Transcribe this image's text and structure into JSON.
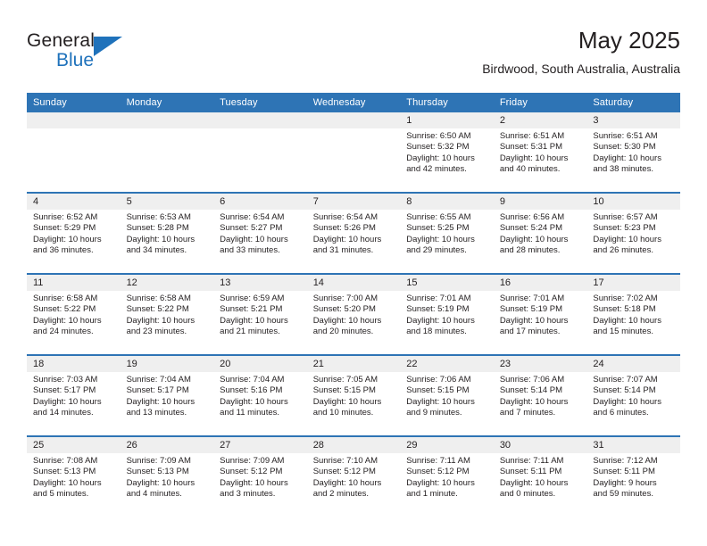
{
  "logo": {
    "word1": "General",
    "word2": "Blue",
    "triangle_icon": "triangle-icon",
    "brand_color": "#1f72bb"
  },
  "header": {
    "title": "May 2025",
    "subtitle": "Birdwood, South Australia, Australia"
  },
  "theme": {
    "header_blue": "#2e74b5",
    "daynum_band": "#efefef",
    "text": "#231f20"
  },
  "weekday_headers": [
    "Sunday",
    "Monday",
    "Tuesday",
    "Wednesday",
    "Thursday",
    "Friday",
    "Saturday"
  ],
  "weeks": [
    [
      {
        "day": "",
        "empty": true
      },
      {
        "day": "",
        "empty": true
      },
      {
        "day": "",
        "empty": true
      },
      {
        "day": "",
        "empty": true
      },
      {
        "day": "1",
        "sunrise": "Sunrise: 6:50 AM",
        "sunset": "Sunset: 5:32 PM",
        "daylight1": "Daylight: 10 hours",
        "daylight2": "and 42 minutes."
      },
      {
        "day": "2",
        "sunrise": "Sunrise: 6:51 AM",
        "sunset": "Sunset: 5:31 PM",
        "daylight1": "Daylight: 10 hours",
        "daylight2": "and 40 minutes."
      },
      {
        "day": "3",
        "sunrise": "Sunrise: 6:51 AM",
        "sunset": "Sunset: 5:30 PM",
        "daylight1": "Daylight: 10 hours",
        "daylight2": "and 38 minutes."
      }
    ],
    [
      {
        "day": "4",
        "sunrise": "Sunrise: 6:52 AM",
        "sunset": "Sunset: 5:29 PM",
        "daylight1": "Daylight: 10 hours",
        "daylight2": "and 36 minutes."
      },
      {
        "day": "5",
        "sunrise": "Sunrise: 6:53 AM",
        "sunset": "Sunset: 5:28 PM",
        "daylight1": "Daylight: 10 hours",
        "daylight2": "and 34 minutes."
      },
      {
        "day": "6",
        "sunrise": "Sunrise: 6:54 AM",
        "sunset": "Sunset: 5:27 PM",
        "daylight1": "Daylight: 10 hours",
        "daylight2": "and 33 minutes."
      },
      {
        "day": "7",
        "sunrise": "Sunrise: 6:54 AM",
        "sunset": "Sunset: 5:26 PM",
        "daylight1": "Daylight: 10 hours",
        "daylight2": "and 31 minutes."
      },
      {
        "day": "8",
        "sunrise": "Sunrise: 6:55 AM",
        "sunset": "Sunset: 5:25 PM",
        "daylight1": "Daylight: 10 hours",
        "daylight2": "and 29 minutes."
      },
      {
        "day": "9",
        "sunrise": "Sunrise: 6:56 AM",
        "sunset": "Sunset: 5:24 PM",
        "daylight1": "Daylight: 10 hours",
        "daylight2": "and 28 minutes."
      },
      {
        "day": "10",
        "sunrise": "Sunrise: 6:57 AM",
        "sunset": "Sunset: 5:23 PM",
        "daylight1": "Daylight: 10 hours",
        "daylight2": "and 26 minutes."
      }
    ],
    [
      {
        "day": "11",
        "sunrise": "Sunrise: 6:58 AM",
        "sunset": "Sunset: 5:22 PM",
        "daylight1": "Daylight: 10 hours",
        "daylight2": "and 24 minutes."
      },
      {
        "day": "12",
        "sunrise": "Sunrise: 6:58 AM",
        "sunset": "Sunset: 5:22 PM",
        "daylight1": "Daylight: 10 hours",
        "daylight2": "and 23 minutes."
      },
      {
        "day": "13",
        "sunrise": "Sunrise: 6:59 AM",
        "sunset": "Sunset: 5:21 PM",
        "daylight1": "Daylight: 10 hours",
        "daylight2": "and 21 minutes."
      },
      {
        "day": "14",
        "sunrise": "Sunrise: 7:00 AM",
        "sunset": "Sunset: 5:20 PM",
        "daylight1": "Daylight: 10 hours",
        "daylight2": "and 20 minutes."
      },
      {
        "day": "15",
        "sunrise": "Sunrise: 7:01 AM",
        "sunset": "Sunset: 5:19 PM",
        "daylight1": "Daylight: 10 hours",
        "daylight2": "and 18 minutes."
      },
      {
        "day": "16",
        "sunrise": "Sunrise: 7:01 AM",
        "sunset": "Sunset: 5:19 PM",
        "daylight1": "Daylight: 10 hours",
        "daylight2": "and 17 minutes."
      },
      {
        "day": "17",
        "sunrise": "Sunrise: 7:02 AM",
        "sunset": "Sunset: 5:18 PM",
        "daylight1": "Daylight: 10 hours",
        "daylight2": "and 15 minutes."
      }
    ],
    [
      {
        "day": "18",
        "sunrise": "Sunrise: 7:03 AM",
        "sunset": "Sunset: 5:17 PM",
        "daylight1": "Daylight: 10 hours",
        "daylight2": "and 14 minutes."
      },
      {
        "day": "19",
        "sunrise": "Sunrise: 7:04 AM",
        "sunset": "Sunset: 5:17 PM",
        "daylight1": "Daylight: 10 hours",
        "daylight2": "and 13 minutes."
      },
      {
        "day": "20",
        "sunrise": "Sunrise: 7:04 AM",
        "sunset": "Sunset: 5:16 PM",
        "daylight1": "Daylight: 10 hours",
        "daylight2": "and 11 minutes."
      },
      {
        "day": "21",
        "sunrise": "Sunrise: 7:05 AM",
        "sunset": "Sunset: 5:15 PM",
        "daylight1": "Daylight: 10 hours",
        "daylight2": "and 10 minutes."
      },
      {
        "day": "22",
        "sunrise": "Sunrise: 7:06 AM",
        "sunset": "Sunset: 5:15 PM",
        "daylight1": "Daylight: 10 hours",
        "daylight2": "and 9 minutes."
      },
      {
        "day": "23",
        "sunrise": "Sunrise: 7:06 AM",
        "sunset": "Sunset: 5:14 PM",
        "daylight1": "Daylight: 10 hours",
        "daylight2": "and 7 minutes."
      },
      {
        "day": "24",
        "sunrise": "Sunrise: 7:07 AM",
        "sunset": "Sunset: 5:14 PM",
        "daylight1": "Daylight: 10 hours",
        "daylight2": "and 6 minutes."
      }
    ],
    [
      {
        "day": "25",
        "sunrise": "Sunrise: 7:08 AM",
        "sunset": "Sunset: 5:13 PM",
        "daylight1": "Daylight: 10 hours",
        "daylight2": "and 5 minutes."
      },
      {
        "day": "26",
        "sunrise": "Sunrise: 7:09 AM",
        "sunset": "Sunset: 5:13 PM",
        "daylight1": "Daylight: 10 hours",
        "daylight2": "and 4 minutes."
      },
      {
        "day": "27",
        "sunrise": "Sunrise: 7:09 AM",
        "sunset": "Sunset: 5:12 PM",
        "daylight1": "Daylight: 10 hours",
        "daylight2": "and 3 minutes."
      },
      {
        "day": "28",
        "sunrise": "Sunrise: 7:10 AM",
        "sunset": "Sunset: 5:12 PM",
        "daylight1": "Daylight: 10 hours",
        "daylight2": "and 2 minutes."
      },
      {
        "day": "29",
        "sunrise": "Sunrise: 7:11 AM",
        "sunset": "Sunset: 5:12 PM",
        "daylight1": "Daylight: 10 hours",
        "daylight2": "and 1 minute."
      },
      {
        "day": "30",
        "sunrise": "Sunrise: 7:11 AM",
        "sunset": "Sunset: 5:11 PM",
        "daylight1": "Daylight: 10 hours",
        "daylight2": "and 0 minutes."
      },
      {
        "day": "31",
        "sunrise": "Sunrise: 7:12 AM",
        "sunset": "Sunset: 5:11 PM",
        "daylight1": "Daylight: 9 hours",
        "daylight2": "and 59 minutes."
      }
    ]
  ]
}
